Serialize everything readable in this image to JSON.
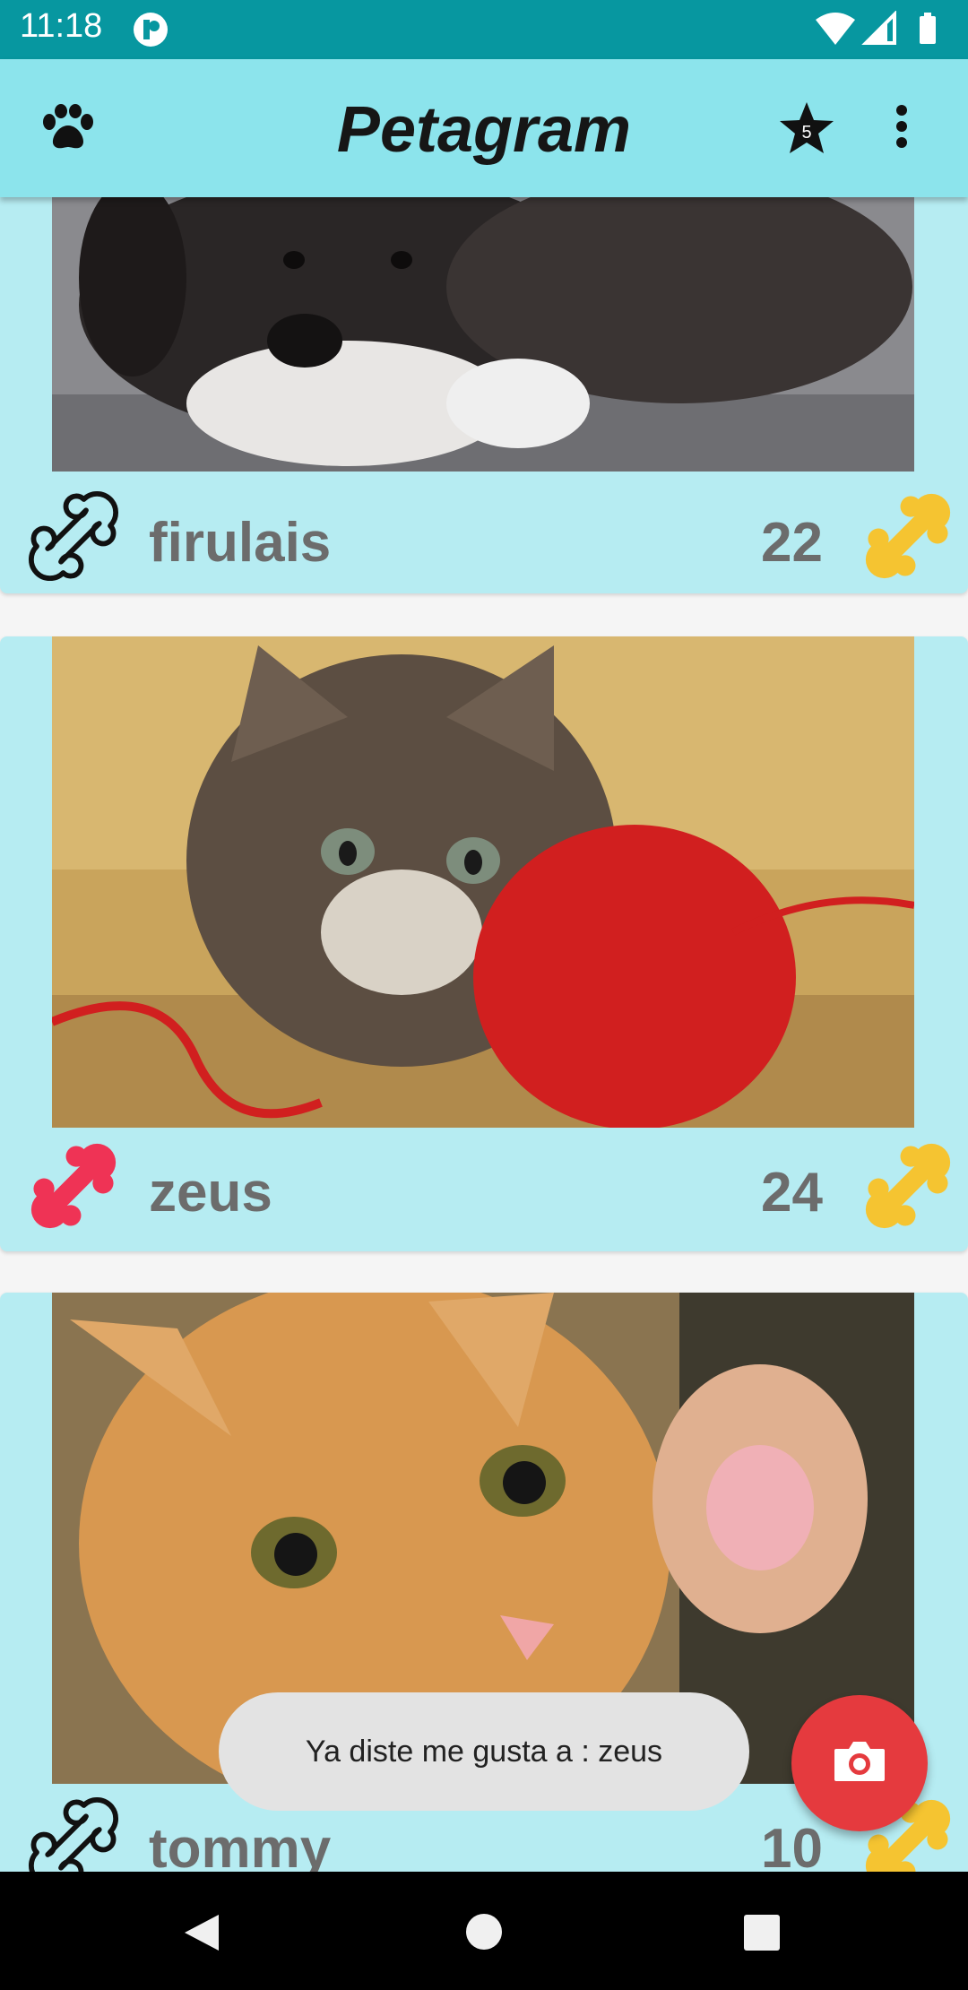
{
  "status_bar": {
    "time": "11:18"
  },
  "app_bar": {
    "title": "Petagram",
    "favorites_badge": "5"
  },
  "pets": [
    {
      "name": "firulais",
      "likes": "22",
      "liked": false
    },
    {
      "name": "zeus",
      "likes": "24",
      "liked": true
    },
    {
      "name": "tommy",
      "likes": "10",
      "liked": false
    }
  ],
  "toast": {
    "message": "Ya diste me gusta a :  zeus"
  },
  "colors": {
    "status_bar": "#0797a0",
    "app_bar": "#8ce4ec",
    "card": "#b6ecf2",
    "bone_gold": "#f5c431",
    "bone_liked": "#ef3355",
    "fab": "#e53a3e"
  },
  "icons": {
    "app_bar_left": "paw-icon",
    "app_bar_star": "star-icon",
    "app_bar_menu": "more-vert-icon",
    "like_button": "bone-icon",
    "rating": "gold-bone-icon",
    "fab": "camera-icon"
  }
}
